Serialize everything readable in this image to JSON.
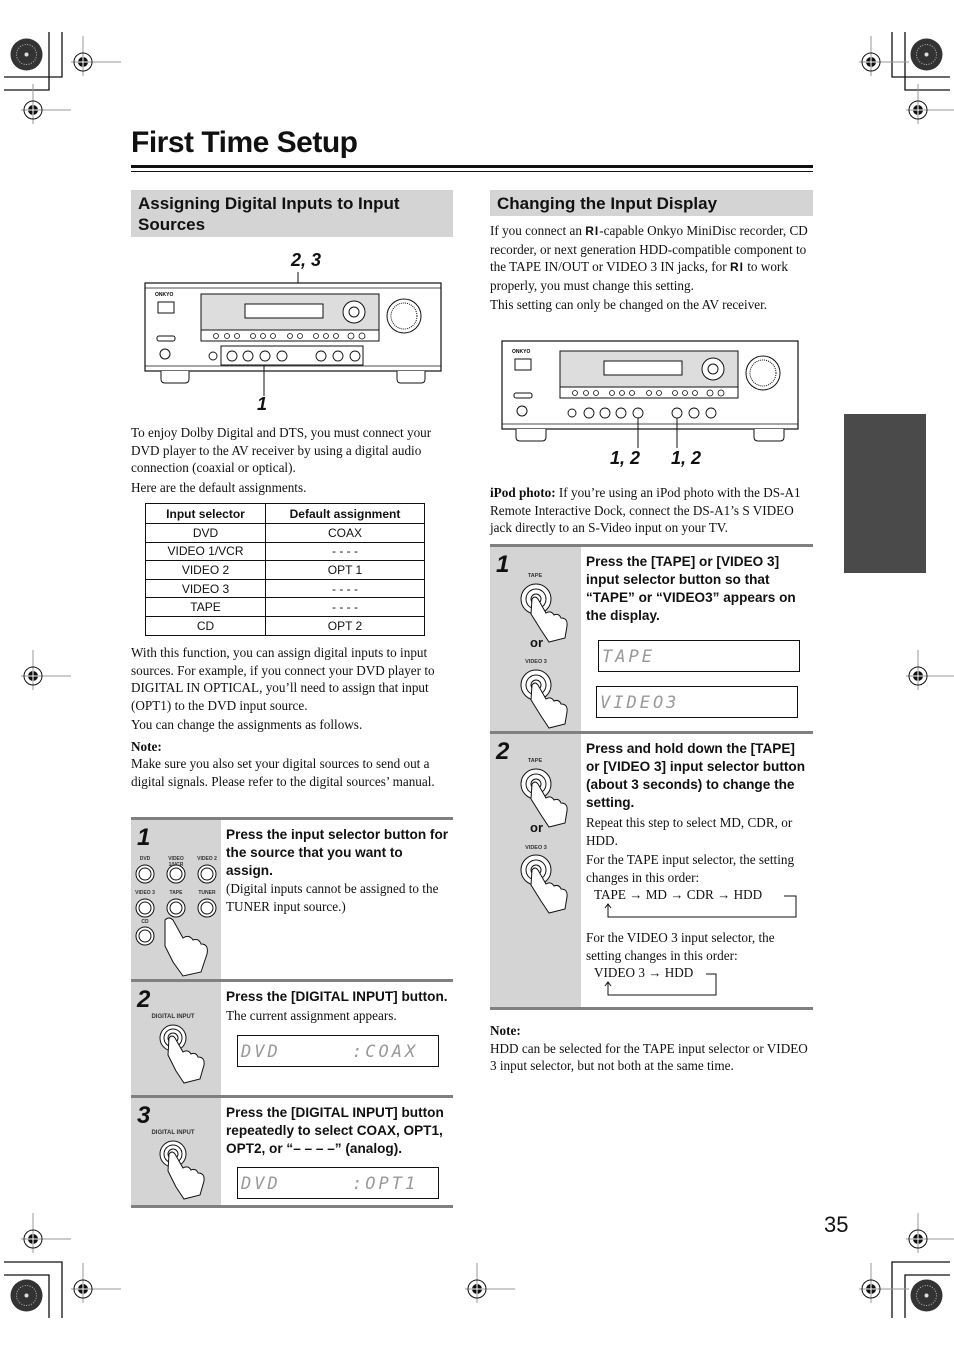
{
  "page": {
    "title": "First Time Setup",
    "page_number": "35"
  },
  "left": {
    "heading": "Assigning Digital Inputs to Input Sources",
    "callout_top": "2, 3",
    "callout_bottom": "1",
    "intro": [
      "To enjoy Dolby Digital and DTS, you must connect your DVD player to the AV receiver by using a digital audio connection (coaxial or optical).",
      "Here are the default assignments."
    ],
    "table": {
      "headers": [
        "Input selector",
        "Default assignment"
      ],
      "rows": [
        [
          "DVD",
          "COAX"
        ],
        [
          "VIDEO 1/VCR",
          "- - - -"
        ],
        [
          "VIDEO 2",
          "OPT 1"
        ],
        [
          "VIDEO 3",
          "- - - -"
        ],
        [
          "TAPE",
          "- - - -"
        ],
        [
          "CD",
          "OPT 2"
        ]
      ]
    },
    "after_table": [
      "With this function, you can assign digital inputs to input sources. For example, if you connect your DVD player to DIGITAL IN OPTICAL, you’ll need to assign that input (OPT1) to the DVD input source.",
      "You can change the assignments as follows."
    ],
    "note_label": "Note:",
    "note_text": "Make sure you also set your digital sources to send out a digital signals. Please refer to the digital sources’ manual.",
    "steps": [
      {
        "num": "1",
        "heading": "Press the input selector button for the source that you want to assign.",
        "text": "(Digital inputs cannot be assigned to the TUNER input source.)",
        "button_labels": [
          "DVD",
          "VIDEO 1/VCR",
          "VIDEO 2",
          "VIDEO 3",
          "TAPE",
          "TUNER",
          "CD"
        ]
      },
      {
        "num": "2",
        "heading": "Press the [DIGITAL INPUT] button.",
        "text": "The current assignment appears.",
        "button_label": "DIGITAL INPUT",
        "display_left": "DVD",
        "display_right": ":COAX"
      },
      {
        "num": "3",
        "heading": "Press the [DIGITAL INPUT] button repeatedly to select COAX, OPT1, OPT2, or “– – – –” (analog).",
        "button_label": "DIGITAL INPUT",
        "display_left": "DVD",
        "display_right": ":OPT1"
      }
    ]
  },
  "right": {
    "heading": "Changing the Input Display",
    "intro_1a": "If you connect an",
    "intro_1b": "-capable Onkyo MiniDisc recorder, CD recorder, or next generation HDD-compatible component to the TAPE IN/OUT or VIDEO 3 IN jacks, for",
    "intro_1c": "to work properly, you must change this setting.",
    "ri_logo": "RI",
    "intro_2": "This setting can only be changed on the AV receiver.",
    "callout_left": "1, 2",
    "callout_right": "1, 2",
    "ipod_label": "iPod photo:",
    "ipod_text": "If you’re using an iPod photo with the DS-A1 Remote Interactive Dock, connect the DS-A1’s S VIDEO jack directly to an S-Video input on your TV.",
    "steps": [
      {
        "num": "1",
        "heading": "Press the [TAPE] or [VIDEO 3] input selector button so that “TAPE” or “VIDEO3” appears on the display.",
        "label_top": "TAPE",
        "or": "or",
        "label_bottom": "VIDEO 3",
        "display_1": "TAPE",
        "display_2": "VIDEO3"
      },
      {
        "num": "2",
        "heading": "Press and hold down the [TAPE] or [VIDEO 3] input selector button (about 3 seconds) to change the setting.",
        "label_top": "TAPE",
        "or": "or",
        "label_bottom": "VIDEO 3",
        "text_1": "Repeat this step to select MD, CDR, or HDD.",
        "text_2": "For the TAPE input selector, the setting changes in this order:",
        "cycle_1": "TAPE → MD → CDR → HDD",
        "text_3": "For the VIDEO 3 input selector, the setting changes in this order:",
        "cycle_2": "VIDEO 3 → HDD"
      }
    ],
    "note_label": "Note:",
    "note_text": "HDD can be selected for the TAPE input selector or VIDEO 3 input selector, but not both at the same time."
  },
  "receiver": {
    "brand": "ONKYO"
  }
}
